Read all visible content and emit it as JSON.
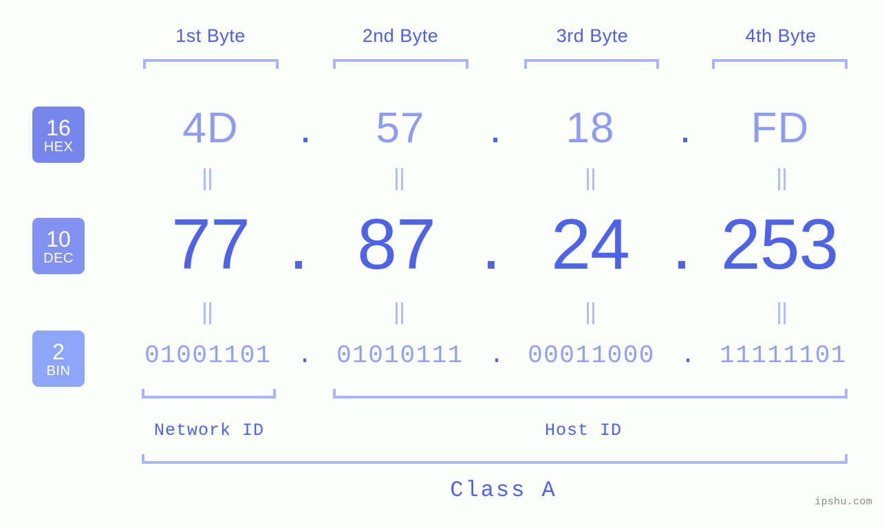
{
  "colors": {
    "background": "#fcfefa",
    "accent_strong": "#4f63e8",
    "accent_mid": "#8e9cf2",
    "accent_light": "#aab4fa",
    "badge_hex": "#7786ec",
    "badge_dec": "#8391f0",
    "badge_bin": "#8ea6f7",
    "watermark": "#8a8a8a"
  },
  "header": {
    "byte_labels": [
      "1st Byte",
      "2nd Byte",
      "3rd Byte",
      "4th Byte"
    ]
  },
  "bases": [
    {
      "num": "16",
      "system": "HEX"
    },
    {
      "num": "10",
      "system": "DEC"
    },
    {
      "num": "2",
      "system": "BIN"
    }
  ],
  "rows": {
    "hex": {
      "base": "16",
      "label": "HEX",
      "values": [
        "4D",
        "57",
        "18",
        "FD"
      ],
      "separator": "."
    },
    "dec": {
      "base": "10",
      "label": "DEC",
      "values": [
        "77",
        "87",
        "24",
        "253"
      ],
      "separator": ".",
      "address": "77.87.24.253"
    },
    "bin": {
      "base": "2",
      "label": "BIN",
      "values": [
        "01001101",
        "01010111",
        "00011000",
        "11111101"
      ],
      "separator": ".",
      "address": "01001101.01010111.00011000.11111101"
    }
  },
  "equality_marks": {
    "glyph": "||",
    "row1_count": 4,
    "row2_count": 4
  },
  "footer": {
    "network_id_label": "Network ID",
    "host_id_label": "Host ID",
    "class_label": "Class A"
  },
  "watermark": {
    "text": "ipshu.com"
  }
}
